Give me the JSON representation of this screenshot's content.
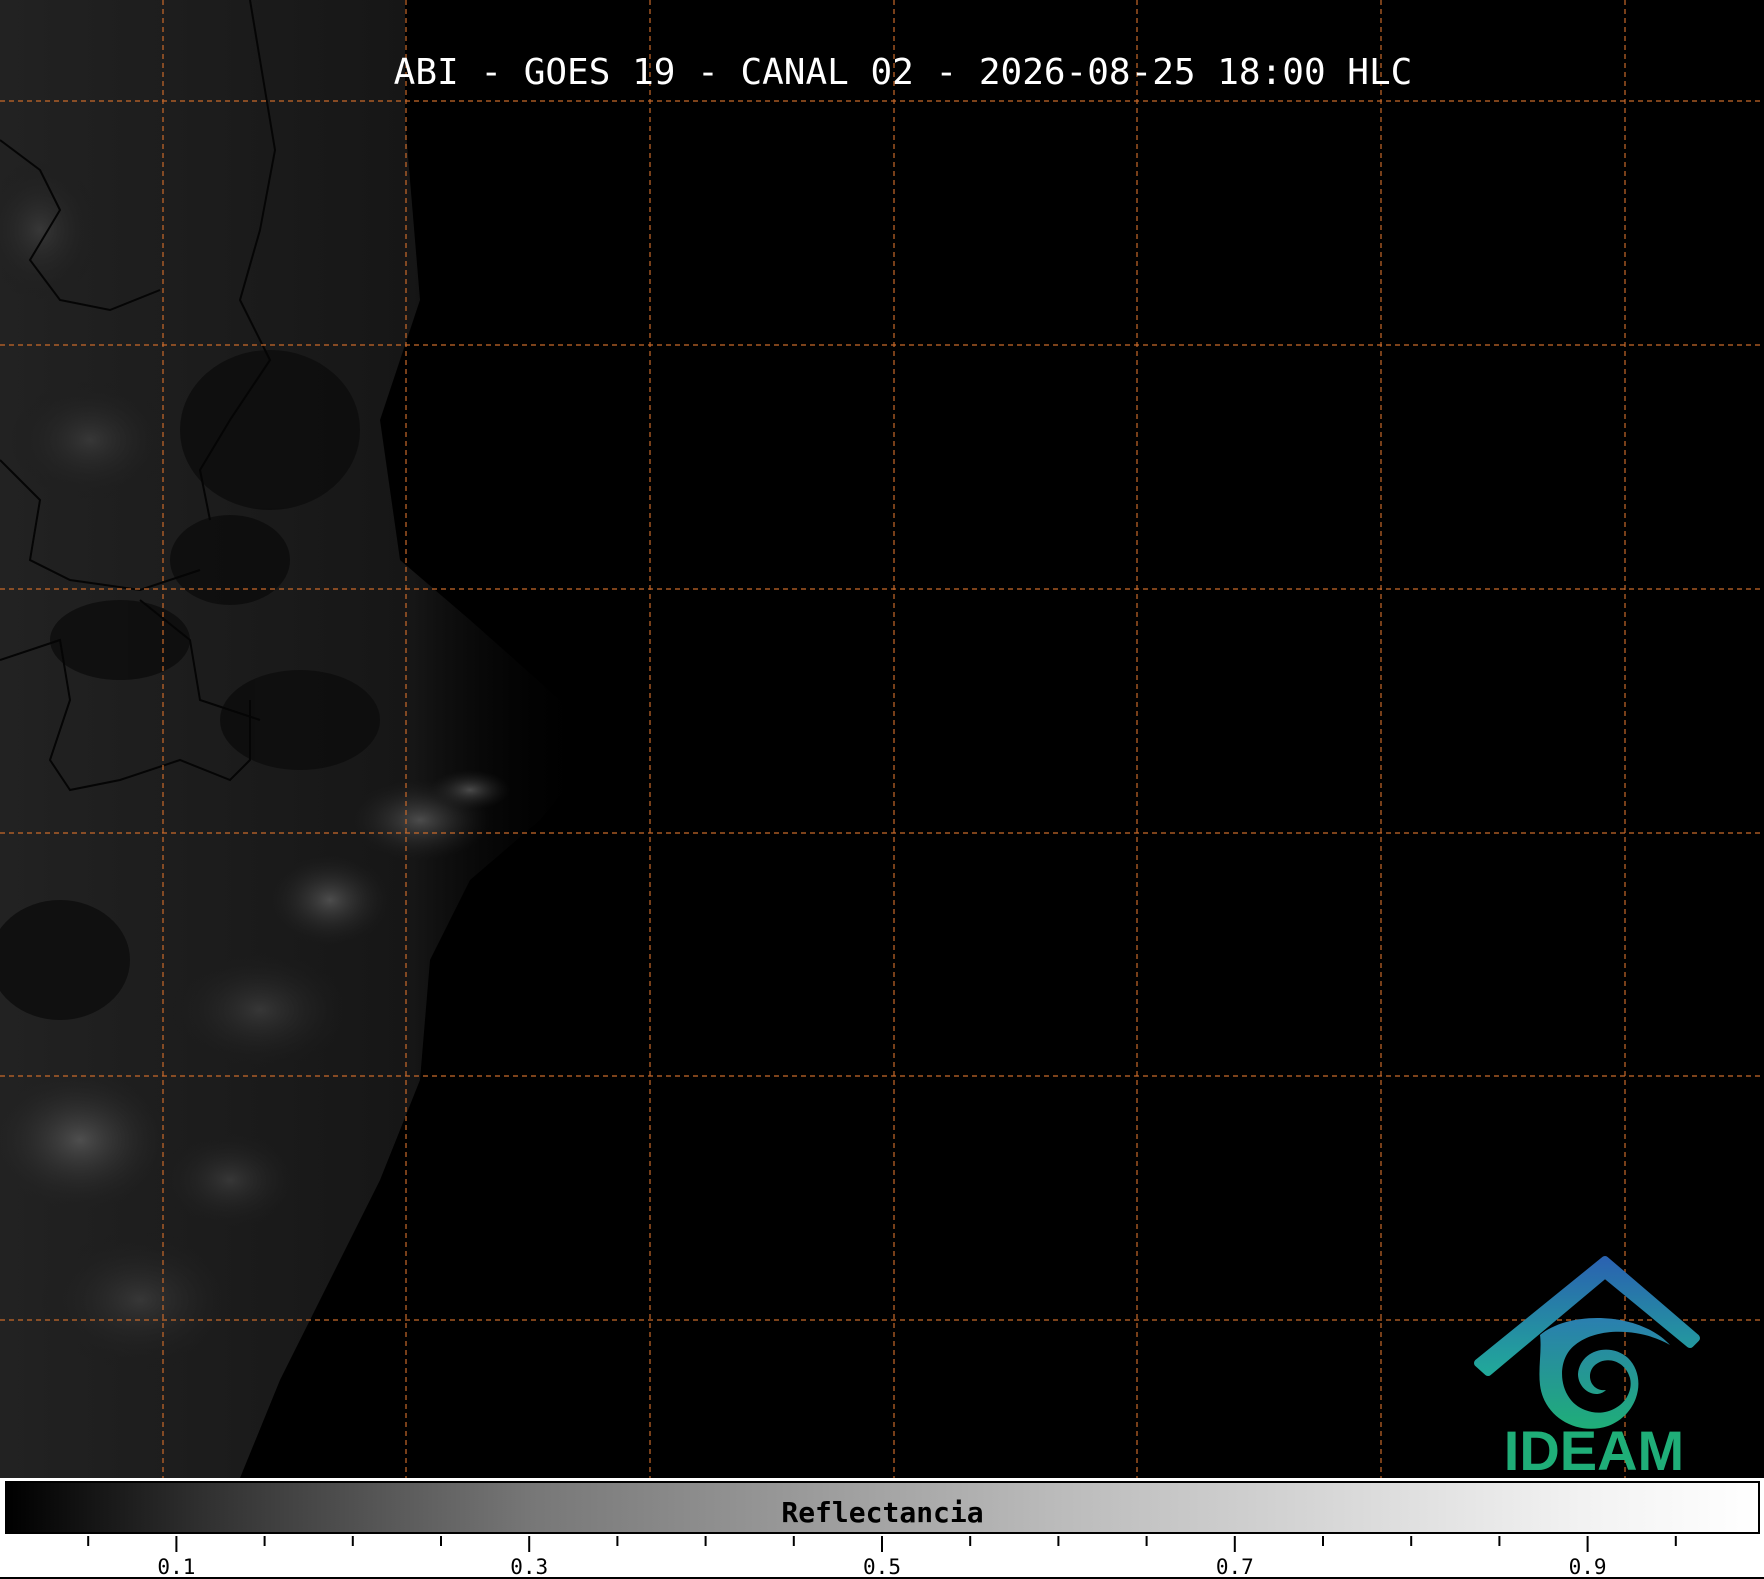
{
  "map": {
    "title": "ABI - GOES 19 - CANAL 02 - 2026-08-25 18:00 HLC",
    "grid_color": "#c8692a"
  },
  "logo": {
    "text": "IDEAM",
    "colors": {
      "roof_blue": "#2a63b0",
      "teal": "#21a89a",
      "green_text": "#1fae78"
    }
  },
  "colorbar": {
    "label": "Reflectancia",
    "range": [
      0.0,
      1.0
    ],
    "major_ticks": [
      "0.1",
      "0.3",
      "0.5",
      "0.7",
      "0.9"
    ],
    "colormap": "grayscale"
  }
}
